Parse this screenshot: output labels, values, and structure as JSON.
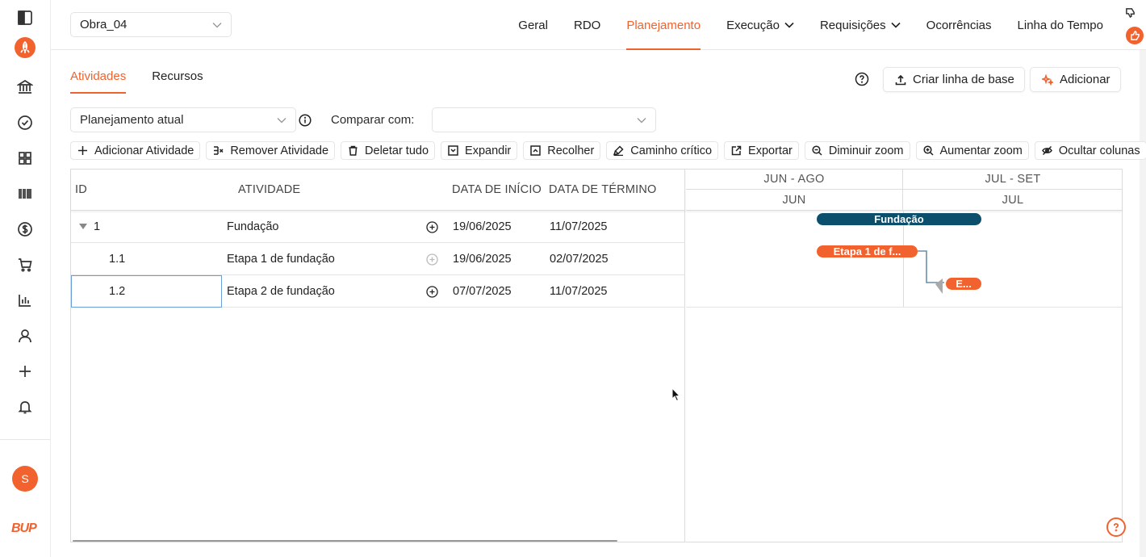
{
  "header": {
    "project": "Obra_04",
    "nav": [
      {
        "label": "Geral",
        "active": false,
        "dropdown": false
      },
      {
        "label": "RDO",
        "active": false,
        "dropdown": false
      },
      {
        "label": "Planejamento",
        "active": true,
        "dropdown": false
      },
      {
        "label": "Execução",
        "active": false,
        "dropdown": true
      },
      {
        "label": "Requisições",
        "active": false,
        "dropdown": true
      },
      {
        "label": "Ocorrências",
        "active": false,
        "dropdown": false
      },
      {
        "label": "Linha do Tempo",
        "active": false,
        "dropdown": false
      }
    ]
  },
  "sidebar": {
    "icons": [
      "panel-toggle-icon",
      "rocket-icon",
      "bank-icon",
      "check-circle-icon",
      "grid-icon",
      "barcode-icon",
      "dollar-icon",
      "cart-icon",
      "bar-chart-icon",
      "user-icon",
      "plus-icon",
      "bell-icon"
    ],
    "avatar_initial": "S",
    "logo": "BUP"
  },
  "subtabs": {
    "atividades": "Atividades",
    "recursos": "Recursos"
  },
  "actions": {
    "baseline": "Criar linha de base",
    "add": "Adicionar"
  },
  "filters": {
    "plan_value": "Planejamento atual",
    "compare_label": "Comparar com:",
    "compare_value": ""
  },
  "toolbar": {
    "add_activity": "Adicionar Atividade",
    "remove_activity": "Remover Atividade",
    "delete_all": "Deletar tudo",
    "expand": "Expandir",
    "collapse": "Recolher",
    "critical_path": "Caminho crítico",
    "export": "Exportar",
    "zoom_out": "Diminuir zoom",
    "zoom_in": "Aumentar zoom",
    "hide_columns": "Ocultar colunas"
  },
  "table": {
    "headers": {
      "id": "ID",
      "activity": "ATIVIDADE",
      "start": "DATA DE INÍCIO",
      "end": "DATA DE TÉRMINO"
    },
    "rows": [
      {
        "id": "1",
        "name": "Fundação",
        "start": "19/06/2025",
        "end": "11/07/2025"
      },
      {
        "id": "1.1",
        "name": "Etapa 1 de fundação",
        "start": "19/06/2025",
        "end": "02/07/2025"
      },
      {
        "id": "1.2",
        "name": "Etapa 2 de fundação",
        "start": "07/07/2025",
        "end": "11/07/2025"
      }
    ]
  },
  "timeline": {
    "top": [
      "JUN - AGO",
      "JUL - SET"
    ],
    "bottom": [
      "JUN",
      "JUL"
    ],
    "bars": [
      {
        "label": "Fundação",
        "kind": "summary"
      },
      {
        "label": "Etapa 1 de f...",
        "kind": "task"
      },
      {
        "label": "E...",
        "kind": "task"
      }
    ],
    "colors": {
      "summary": "#0b4f6c",
      "task": "#f2622e"
    }
  },
  "colors": {
    "accent": "#f2622e"
  }
}
